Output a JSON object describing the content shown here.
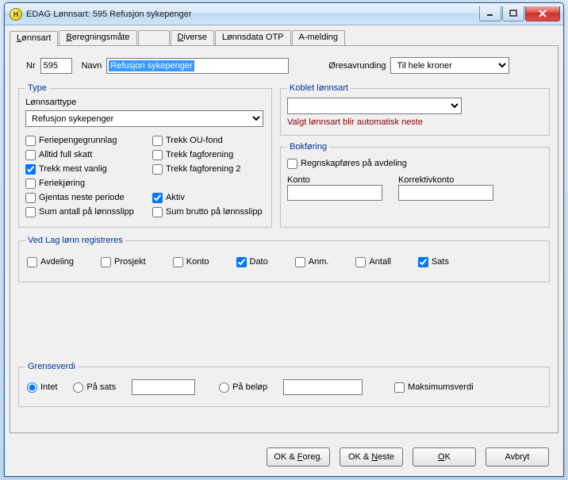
{
  "window": {
    "title": "EDAG Lønnsart: 595 Refusjon sykepenger",
    "app_icon_letter": "H"
  },
  "tabs": {
    "lonnsart": "Lønnsart",
    "beregningsmate": "Beregningsmåte",
    "diverse": "Diverse",
    "lonnsdata_otp": "Lønnsdata OTP",
    "amelding": "A-melding"
  },
  "header": {
    "nr_label": "Nr",
    "nr_value": "595",
    "navn_label": "Navn",
    "navn_value": "Refusjon sykepenger",
    "ores_label": "Øresavrunding",
    "ores_value": "Til hele kroner"
  },
  "type_group": {
    "legend": "Type",
    "lonnsarttype_label": "Lønnsarttype",
    "lonnsarttype_value": "Refusjon sykepenger",
    "cb": {
      "feriepengegrunnlag": "Feriepengegrunnlag",
      "alltid_full_skatt": "Alltid full skatt",
      "trekk_mest_vanlig": "Trekk mest vanlig",
      "feriekjoring": "Feriekjøring",
      "gjentas_neste_periode": "Gjentas neste periode",
      "sum_antall": "Sum antall på lønnsslipp",
      "trekk_ou_fond": "Trekk OU-fond",
      "trekk_fagforening": "Trekk fagforening",
      "trekk_fagforening2": "Trekk fagforening 2",
      "aktiv": "Aktiv",
      "sum_brutto": "Sum brutto på lønnsslipp"
    }
  },
  "koblet_group": {
    "legend": "Koblet lønnsart",
    "warn": "Valgt lønnsart blir automatisk neste"
  },
  "bokforing_group": {
    "legend": "Bokføring",
    "regnskap": "Regnskapføres på avdeling",
    "konto_label": "Konto",
    "korrektiv_label": "Korrektivkonto"
  },
  "vedlag_group": {
    "legend": "Ved Lag lønn registreres",
    "items": {
      "avdeling": "Avdeling",
      "prosjekt": "Prosjekt",
      "konto": "Konto",
      "dato": "Dato",
      "anm": "Anm.",
      "antall": "Antall",
      "sats": "Sats"
    }
  },
  "grense_group": {
    "legend": "Grenseverdi",
    "intet": "Intet",
    "pa_sats": "På sats",
    "pa_belop": "På beløp",
    "maksimum": "Maksimumsverdi"
  },
  "buttons": {
    "ok_foreg": "OK & Foreg.",
    "ok_neste": "OK & Neste",
    "ok": "OK",
    "avbryt": "Avbryt"
  }
}
